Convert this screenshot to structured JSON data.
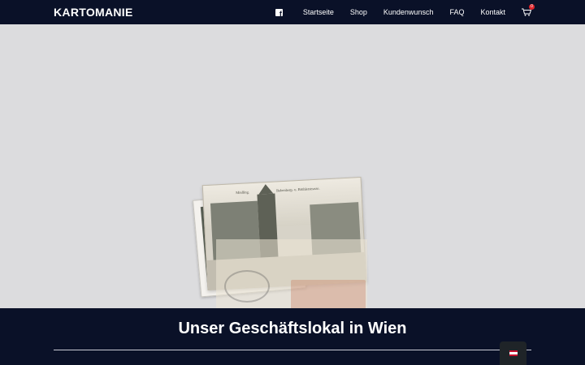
{
  "header": {
    "logo": "KARTOMANIE",
    "nav": [
      {
        "label": "Startseite"
      },
      {
        "label": "Shop"
      },
      {
        "label": "Kundenwunsch"
      },
      {
        "label": "FAQ"
      },
      {
        "label": "Kontakt"
      }
    ],
    "facebook_icon": "facebook-icon",
    "cart_icon": "shopping-cart-icon",
    "cart_count": "0"
  },
  "hero": {
    "image": "vintage-postcards",
    "postcard_captions": [
      "Mödling.",
      "Babenberg- u. Brühlerstrasse."
    ]
  },
  "section": {
    "title": "Unser Geschäftslokal in Wien"
  },
  "language_switcher": {
    "flag_icon": "austria-flag-icon",
    "colors": [
      "#c8102e",
      "#ffffff",
      "#c8102e"
    ]
  },
  "colors": {
    "header_bg": "#0a1128",
    "hero_bg": "#dcdcde",
    "text_light": "#ffffff",
    "badge": "#e0262c"
  }
}
